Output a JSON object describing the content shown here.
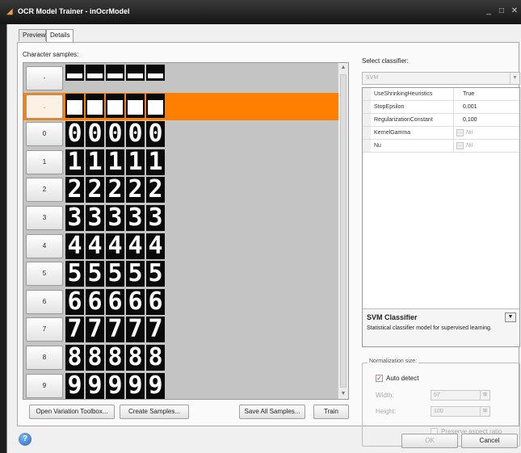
{
  "window": {
    "title": "OCR Model Trainer - inOcrModel",
    "minimize": "_",
    "maximize": "□",
    "close": "✕"
  },
  "tabs": [
    {
      "label": "Preview",
      "active": false
    },
    {
      "label": "Details",
      "active": true
    }
  ],
  "samples": {
    "label": "Character samples:",
    "rows": [
      {
        "label": "-",
        "char": "-",
        "selected": false
      },
      {
        "label": ".",
        "char": ".",
        "selected": true
      },
      {
        "label": "0",
        "char": "0",
        "selected": false
      },
      {
        "label": "1",
        "char": "1",
        "selected": false
      },
      {
        "label": "2",
        "char": "2",
        "selected": false
      },
      {
        "label": "3",
        "char": "3",
        "selected": false
      },
      {
        "label": "4",
        "char": "4",
        "selected": false
      },
      {
        "label": "5",
        "char": "5",
        "selected": false
      },
      {
        "label": "6",
        "char": "6",
        "selected": false
      },
      {
        "label": "7",
        "char": "7",
        "selected": false
      },
      {
        "label": "8",
        "char": "8",
        "selected": false
      },
      {
        "label": "9",
        "char": "9",
        "selected": false
      }
    ],
    "samples_per_row": 5
  },
  "buttons": {
    "open_variation_toolbox": "Open Variation Toolbox...",
    "create_samples": "Create Samples...",
    "save_all_samples": "Save All Samples...",
    "train": "Train"
  },
  "classifier": {
    "label": "Select classifier:",
    "selected": "SVM",
    "properties": [
      {
        "name": "UseShrinkingHeuristics",
        "value": "True",
        "enabled": true
      },
      {
        "name": "StopEpsilon",
        "value": "0,001",
        "enabled": true
      },
      {
        "name": "RegularizationConstant",
        "value": "0,100",
        "enabled": true
      },
      {
        "name": "KernelGamma",
        "value": "Nil",
        "enabled": false
      },
      {
        "name": "Nu",
        "value": "Nil",
        "enabled": false
      }
    ],
    "description_title": "SVM Classifier",
    "description_text": "Statistical classifier model for supervised learning."
  },
  "normalization": {
    "label": "Normalization size:",
    "auto_detect_label": "Auto detect",
    "auto_detect_checked": true,
    "width_label": "Width:",
    "width_value": "57",
    "height_label": "Height:",
    "height_value": "100",
    "preserve_label": "Preserve aspect ratio",
    "preserve_checked": false
  },
  "footer": {
    "ok": "OK",
    "cancel": "Cancel",
    "help_icon": "?"
  },
  "colors": {
    "selection": "#ff8000",
    "titlebar": "#1e1e1e"
  }
}
